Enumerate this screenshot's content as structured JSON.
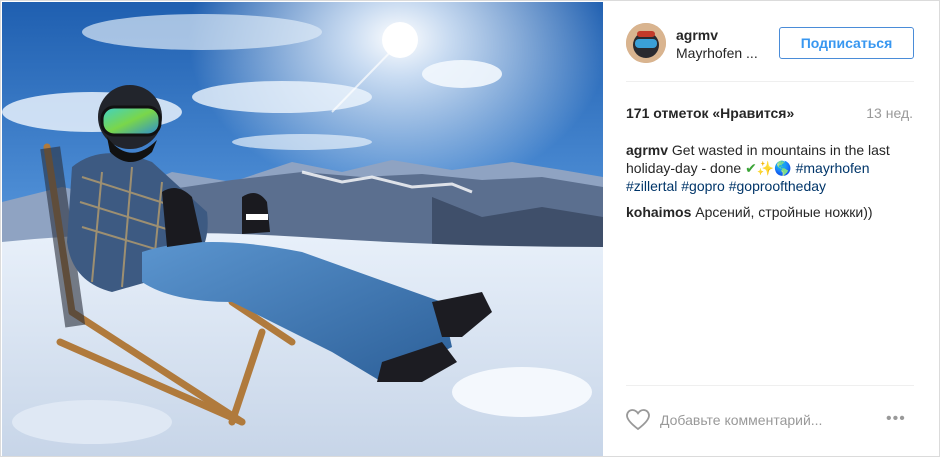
{
  "post": {
    "author": {
      "username": "agrmv",
      "location": "Mayrhofen ...",
      "follow_label": "Подписаться"
    },
    "likes_text": "171 отметок «Нравится»",
    "time_ago": "13 нед.",
    "caption": {
      "user": "agrmv",
      "text_before": "Get wasted in mountains in the last holiday-day - done ",
      "emoji": [
        "✔",
        "✨",
        "🌎"
      ],
      "hashtags": [
        "#mayrhofen",
        "#zillertal",
        "#gopro",
        "#goprooftheday"
      ]
    },
    "comments": [
      {
        "user": "kohaimos",
        "text": "Арсений, стройные ножки))"
      }
    ],
    "add_comment_placeholder": "Добавьте комментарий...",
    "more_label": "•••"
  },
  "icons": {
    "heart": "heart-outline-icon",
    "more": "more-options-icon"
  },
  "colors": {
    "accent": "#3897f0",
    "hashtag": "#003569",
    "muted": "#999999",
    "text": "#262626"
  }
}
